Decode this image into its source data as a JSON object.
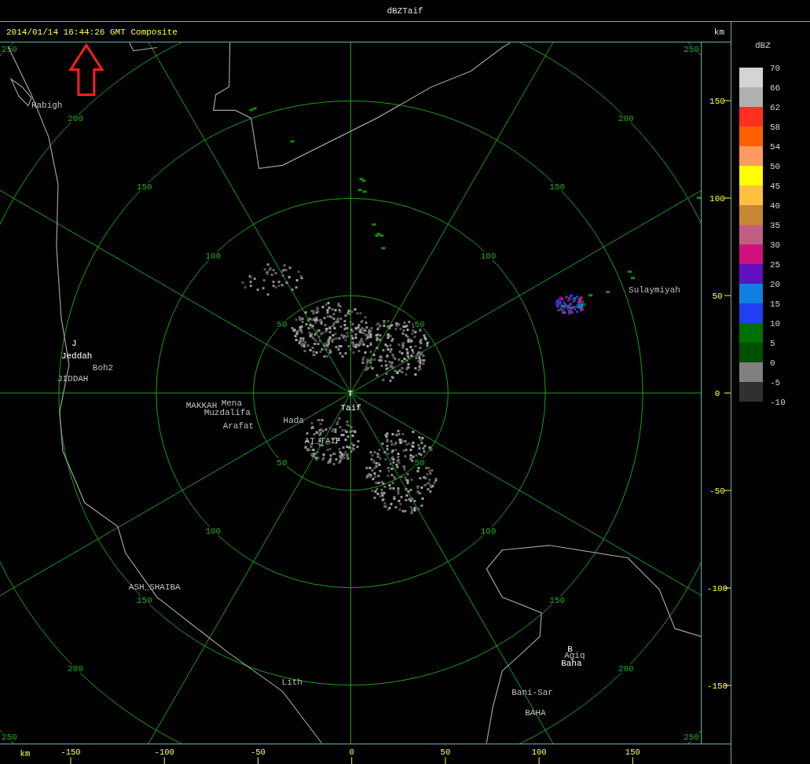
{
  "window": {
    "title": "dBZTaif"
  },
  "header": {
    "timestamp": "2014/01/14 16:44:26 GMT Composite",
    "unit": "km"
  },
  "plot": {
    "range_rings": [
      {
        "labels": [
          "50",
          "50",
          "50",
          "50"
        ]
      },
      {
        "labels": [
          "100",
          "100",
          "100",
          "100"
        ]
      },
      {
        "labels": [
          "150",
          "150",
          "150",
          "150"
        ]
      },
      {
        "labels": [
          "200",
          "200",
          "200",
          "200"
        ]
      },
      {
        "labels": [
          "250",
          "250",
          "250",
          "250"
        ]
      }
    ],
    "places": [
      {
        "name": "Rabigh",
        "kind": "place"
      },
      {
        "name": "J",
        "kind": "station"
      },
      {
        "name": "Jeddah",
        "kind": "station"
      },
      {
        "name": "Boh2",
        "kind": "place"
      },
      {
        "name": "JIDDAH",
        "kind": "place"
      },
      {
        "name": "MAKKAH",
        "kind": "place"
      },
      {
        "name": "Mena",
        "kind": "place"
      },
      {
        "name": "Muzdalifa",
        "kind": "place"
      },
      {
        "name": "Arafat",
        "kind": "place"
      },
      {
        "name": "Hada",
        "kind": "place"
      },
      {
        "name": "AT_TAIF",
        "kind": "place"
      },
      {
        "name": "T",
        "kind": "station"
      },
      {
        "name": "Taif",
        "kind": "station"
      },
      {
        "name": "Sulaymiyah",
        "kind": "place"
      },
      {
        "name": "B",
        "kind": "station"
      },
      {
        "name": "Agiq",
        "kind": "place"
      },
      {
        "name": "Baha",
        "kind": "station"
      },
      {
        "name": "Bani-Sar",
        "kind": "place"
      },
      {
        "name": "BAHA",
        "kind": "place"
      },
      {
        "name": "ASH_SHAIBA",
        "kind": "place"
      },
      {
        "name": "Lith",
        "kind": "place"
      }
    ]
  },
  "y_axis": {
    "ticks": [
      "150",
      "100",
      "50",
      "0",
      "-50",
      "-100",
      "-150"
    ]
  },
  "x_axis": {
    "unit": "km",
    "ticks": [
      "-150",
      "-100",
      "-50",
      "0",
      "50",
      "100",
      "150"
    ]
  },
  "legend": {
    "title": "dBZ",
    "bins": [
      {
        "label": "70",
        "color": "#d4d4d4"
      },
      {
        "label": "66",
        "color": "#b0b0b0"
      },
      {
        "label": "62",
        "color": "#ff3020"
      },
      {
        "label": "58",
        "color": "#ff6000"
      },
      {
        "label": "54",
        "color": "#ff9a60"
      },
      {
        "label": "50",
        "color": "#ffff00"
      },
      {
        "label": "45",
        "color": "#ffc040"
      },
      {
        "label": "40",
        "color": "#c88838"
      },
      {
        "label": "35",
        "color": "#c06080"
      },
      {
        "label": "30",
        "color": "#d0107f"
      },
      {
        "label": "25",
        "color": "#6010c0"
      },
      {
        "label": "20",
        "color": "#1080e0"
      },
      {
        "label": "15",
        "color": "#2040f0"
      },
      {
        "label": "10",
        "color": "#007000"
      },
      {
        "label": "5",
        "color": "#005000"
      },
      {
        "label": "0",
        "color": "#808080"
      },
      {
        "label": "-5",
        "color": "#303030"
      }
    ],
    "bottom_label": "-10"
  }
}
